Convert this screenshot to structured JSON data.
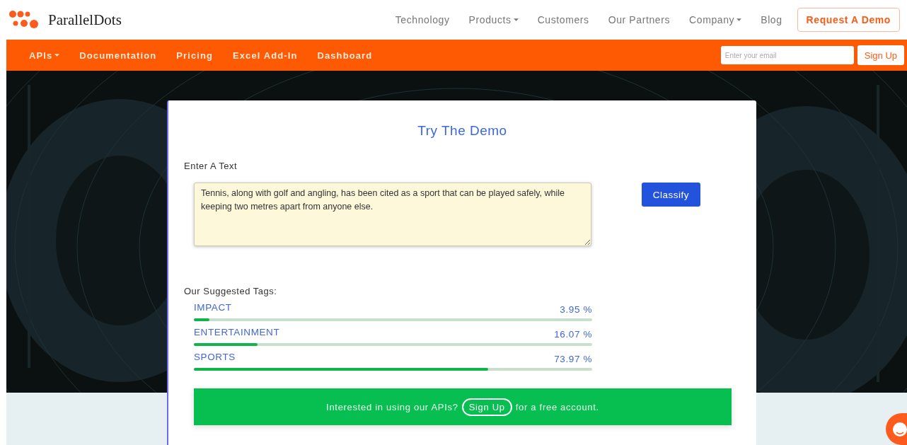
{
  "header": {
    "brand": "ParallelDots",
    "nav": [
      {
        "label": "Technology",
        "dropdown": false
      },
      {
        "label": "Products",
        "dropdown": true
      },
      {
        "label": "Customers",
        "dropdown": false
      },
      {
        "label": "Our Partners",
        "dropdown": false
      },
      {
        "label": "Company",
        "dropdown": true
      },
      {
        "label": "Blog",
        "dropdown": false
      }
    ],
    "cta": "Request A Demo"
  },
  "subnav": {
    "items": [
      {
        "label": "APIs",
        "dropdown": true
      },
      {
        "label": "Documentation",
        "dropdown": false
      },
      {
        "label": "Pricing",
        "dropdown": false
      },
      {
        "label": "Excel Add-In",
        "dropdown": false
      },
      {
        "label": "Dashboard",
        "dropdown": false
      }
    ],
    "email": {
      "placeholder": "Enter your email"
    },
    "signup": "Sign Up"
  },
  "demo": {
    "title": "Try The Demo",
    "input_label": "Enter A Text",
    "text": "Tennis, along with golf and angling, has been cited as a sport that can be played safely, while keeping two metres apart from anyone else.",
    "button": "Classify",
    "tags_label": "Our Suggested Tags:",
    "tags": [
      {
        "name": "IMPACT",
        "reading": "3.95 %",
        "level": 0.0395
      },
      {
        "name": "ENTERTAINMENT",
        "reading": "16.07 %",
        "level": 0.1607
      },
      {
        "name": "SPORTS",
        "reading": "73.97 %",
        "level": 0.7397
      }
    ],
    "banner": {
      "before": "Interested in using our APIs?",
      "link": "Sign Up",
      "after": "for a free account."
    }
  }
}
